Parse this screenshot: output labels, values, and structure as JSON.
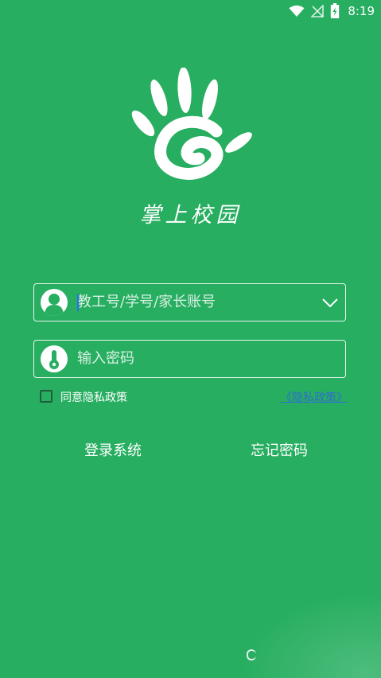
{
  "status_bar": {
    "time": "8:19",
    "icons": [
      "wifi-icon",
      "no-signal-icon",
      "battery-charging-icon"
    ]
  },
  "app": {
    "title": "掌上校园",
    "logo": "hand-logo-icon"
  },
  "login_form": {
    "account_placeholder": "教工号/学号/家长账号",
    "password_placeholder": "输入密码",
    "privacy_label": "同意隐私政策",
    "privacy_link": "《隐私政策》",
    "login_label": "登录系统",
    "forgot_label": "忘记密码"
  },
  "colors": {
    "background": "#27ae60",
    "text": "#ffffff",
    "link": "#2f6fd0",
    "checkbox_border": "#1f5e3a"
  }
}
